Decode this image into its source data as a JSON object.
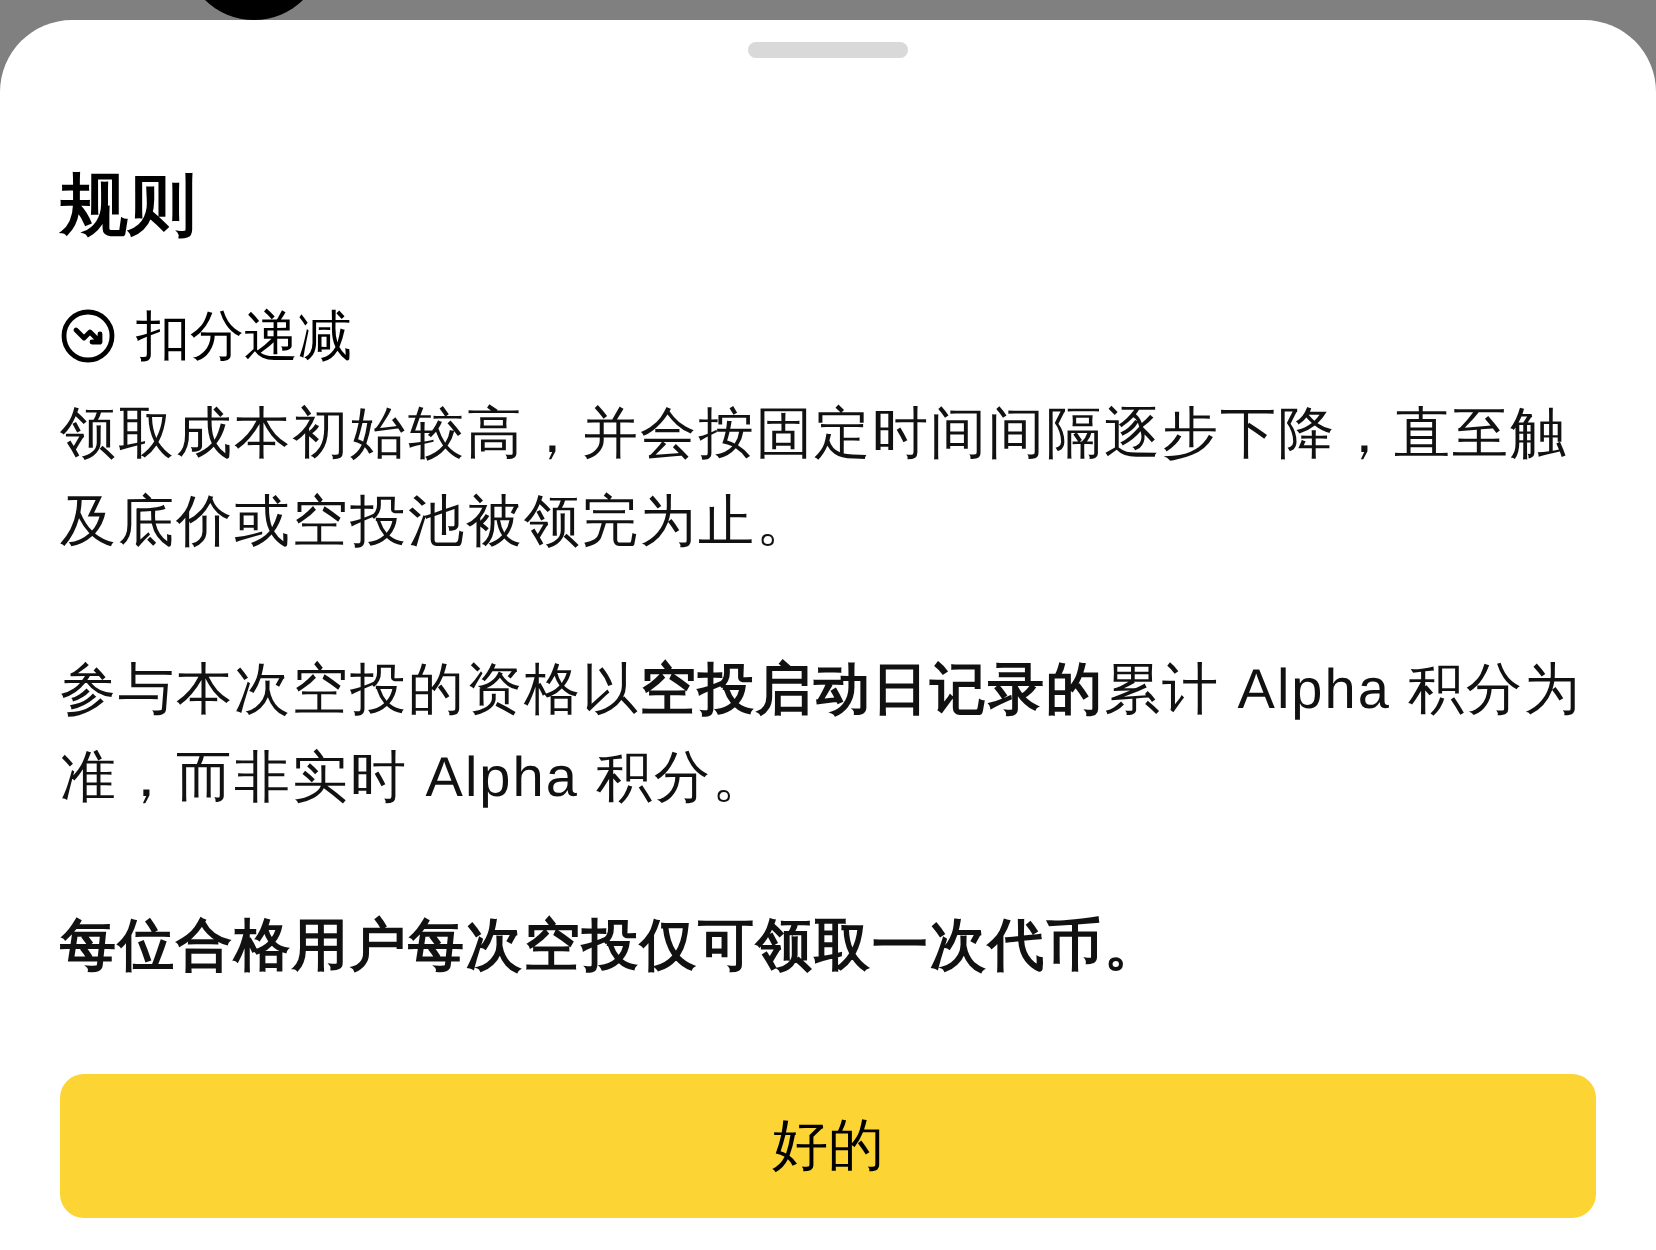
{
  "sheet": {
    "title": "规则",
    "section": {
      "heading": "扣分递减"
    },
    "paragraphs": [
      {
        "text": "领取成本初始较高，并会按固定时间间隔逐步下降，直至触及底价或空投池被领完为止。",
        "emphasis": false
      },
      {
        "text": "参与本次空投的资格以**空投启动日记录的**累计 Alpha 积分为准，而非实时 Alpha 积分。",
        "emphasis": false
      },
      {
        "text": "每位合格用户每次空投仅可领取一次代币。",
        "emphasis": true
      }
    ],
    "button": "好的"
  }
}
